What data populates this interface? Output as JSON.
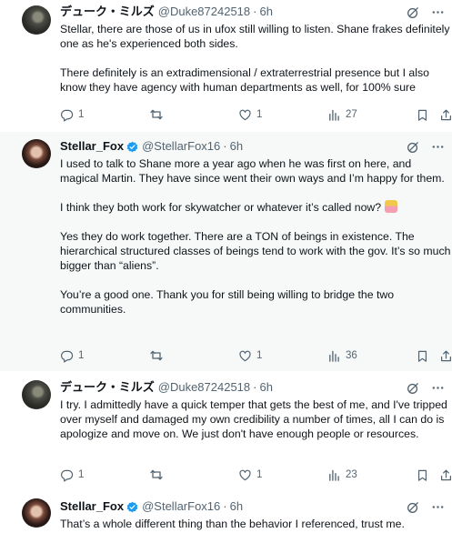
{
  "tweets": [
    {
      "name": "デューク・ミルズ",
      "handle": "@Duke87242518",
      "sep": "·",
      "time": "6h",
      "verified": false,
      "paragraphs": [
        "Stellar, there are those of us in ufox still willing to listen. Shane frakes definitely one as he's experienced both sides.",
        "There definitely is an extradimensional / extraterrestrial presence but I also know they have agency with human departments as well, for 100% sure"
      ],
      "stats": {
        "replies": "1",
        "retweets": "",
        "likes": "1",
        "views": "27"
      }
    },
    {
      "name": "Stellar_Fox",
      "handle": "@StellarFox16",
      "sep": "·",
      "time": "6h",
      "verified": true,
      "paragraphs": [
        "I used to talk to Shane more a year ago when he was first on here, and magical Martin. They have since went their own ways and I’m happy for them.",
        "I think they both work for skywatcher or whatever it’s called now?",
        "Yes they do work together. There are a TON of beings in existence. The hierarchical structured classes of beings tend to work with the gov. It’s so much bigger than “aliens”.",
        "You’re a good one. Thank you for still being willing to bridge the two communities."
      ],
      "stats": {
        "replies": "1",
        "retweets": "",
        "likes": "1",
        "views": "36"
      }
    },
    {
      "name": "デューク・ミルズ",
      "handle": "@Duke87242518",
      "sep": "·",
      "time": "6h",
      "verified": false,
      "paragraphs": [
        "I try. I admittedly have a quick temper that gets the best of me, and I've tripped over myself and damaged my own credibility a number of times, all I can do is apologize and move on. We just don't have enough people or resources."
      ],
      "stats": {
        "replies": "1",
        "retweets": "",
        "likes": "1",
        "views": "23"
      }
    },
    {
      "name": "Stellar_Fox",
      "handle": "@StellarFox16",
      "sep": "·",
      "time": "6h",
      "verified": true,
      "paragraphs": [
        "That’s a whole different thing than the behavior I referenced, trust me."
      ]
    }
  ],
  "icons": {
    "grok": "grok-icon",
    "more": "more-icon",
    "reply": "reply-icon",
    "retweet": "retweet-icon",
    "like": "heart-icon",
    "views": "views-icon",
    "bookmark": "bookmark-icon",
    "share": "share-icon",
    "verified": "verified-badge-icon"
  },
  "colors": {
    "text": "#0f1419",
    "muted": "#536471",
    "verified": "#1d9bf0",
    "highlight_bg": "#f7f9f9"
  }
}
